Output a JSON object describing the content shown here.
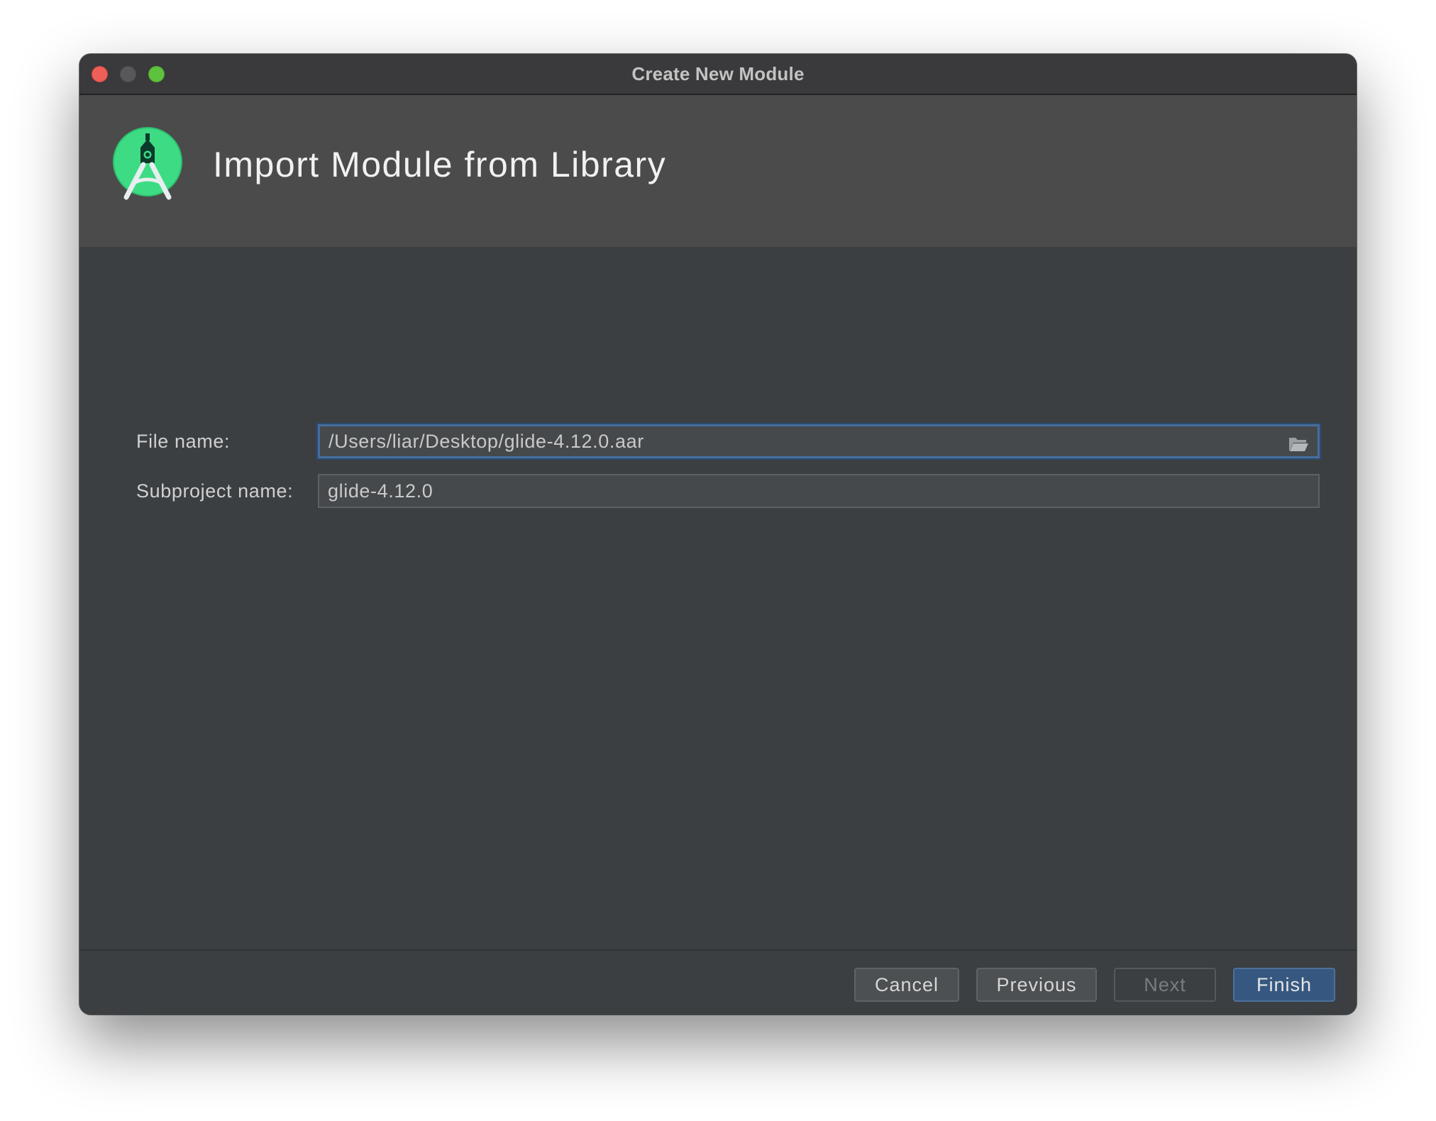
{
  "window": {
    "title": "Create New Module"
  },
  "header": {
    "title": "Import Module from Library",
    "logo_icon": "android-studio-logo-icon"
  },
  "form": {
    "file_name": {
      "label": "File name:",
      "value": "/Users/liar/Desktop/glide-4.12.0.aar",
      "browse_icon": "folder-open-icon"
    },
    "subproject_name": {
      "label": "Subproject name:",
      "value": "glide-4.12.0"
    }
  },
  "buttons": {
    "cancel": "Cancel",
    "previous": "Previous",
    "next": "Next",
    "finish": "Finish"
  },
  "colors": {
    "accent": "#365880",
    "focus_border": "#466d9e",
    "logo_green": "#3ddc84"
  }
}
